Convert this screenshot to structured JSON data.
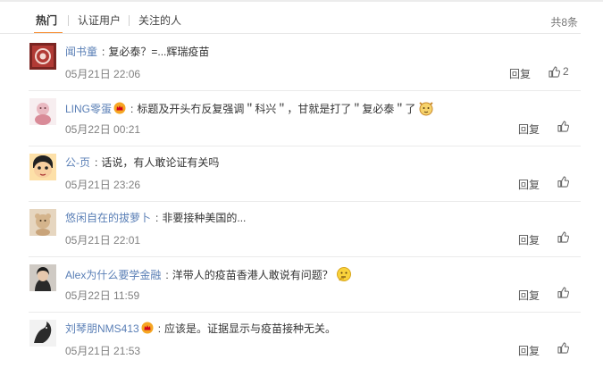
{
  "tabs": {
    "hot": "热门",
    "verified": "认证用户",
    "following": "关注的人",
    "total": "共8条"
  },
  "actions": {
    "reply_label": "回复"
  },
  "comments": [
    {
      "user": "闻书童",
      "text": "复必泰？=...辉瑞疫苗",
      "time": "05月21日 22:06",
      "likes": "2",
      "crown": false,
      "emoji": null
    },
    {
      "user": "LING零蛋",
      "text": "标题及开头冇反复强调＂科兴＂，甘就是打了＂复必泰＂了",
      "time": "05月22日 00:21",
      "likes": "",
      "crown": true,
      "emoji": "cat-face-emoji"
    },
    {
      "user": "公-页",
      "text": "话说，有人敢论证有关吗",
      "time": "05月21日 23:26",
      "likes": "",
      "crown": false,
      "emoji": null
    },
    {
      "user": "悠闲自在的拔萝卜",
      "text": "非要接种美国的...",
      "time": "05月21日 22:01",
      "likes": "",
      "crown": false,
      "emoji": null
    },
    {
      "user": "Alex为什么要学金融",
      "text": "洋带人的疫苗香港人敢说有问题？",
      "time": "05月22日 11:59",
      "likes": "",
      "crown": false,
      "emoji": "thinking-face-emoji"
    },
    {
      "user": "刘琴朋NMS413",
      "text": "应该是。证据显示与疫苗接种无关。",
      "time": "05月21日 21:53",
      "likes": "",
      "crown": true,
      "emoji": null
    }
  ]
}
